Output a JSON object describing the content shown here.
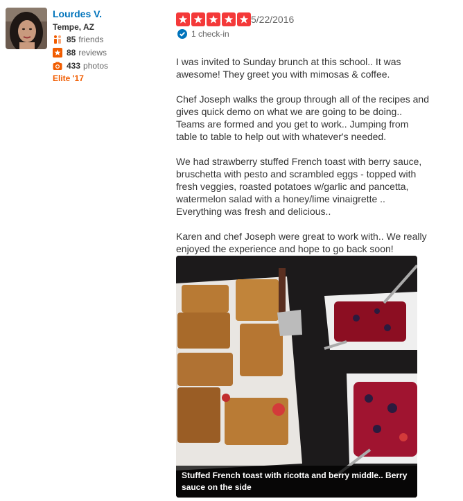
{
  "user": {
    "name": "Lourdes V.",
    "location": "Tempe, AZ",
    "friends_count": "85",
    "friends_label": "friends",
    "reviews_count": "88",
    "reviews_label": "reviews",
    "photos_count": "433",
    "photos_label": "photos",
    "elite": "Elite '17"
  },
  "review": {
    "rating": 5,
    "star_color": "#f43939",
    "date": "5/22/2016",
    "checkin": "1 check-in",
    "paragraphs": [
      "I was invited to Sunday brunch at this school.. It was\nawesome! They greet you with mimosas & coffee.",
      "Chef Joseph walks the group through all of the recipes and\ngives quick demo on what we are going to be doing..\nTeams are formed and you get to work.. Jumping from\ntable to table to help out with whatever's needed.",
      "We had strawberry stuffed French toast with berry sauce,\nbruschetta with pesto and scrambled eggs - topped with\nfresh veggies, roasted potatoes w/garlic and pancetta,\nwatermelon salad with a honey/lime vinaigrette ..\nEverything was fresh and delicious..",
      "Karen and chef Joseph were great to work with.. We really\nenjoyed the experience and hope to go back soon!"
    ],
    "photo_caption": "Stuffed French toast with ricotta and berry middle.. Berry sauce on the side"
  },
  "colors": {
    "link": "#0073bb",
    "elite": "#f15c00"
  }
}
